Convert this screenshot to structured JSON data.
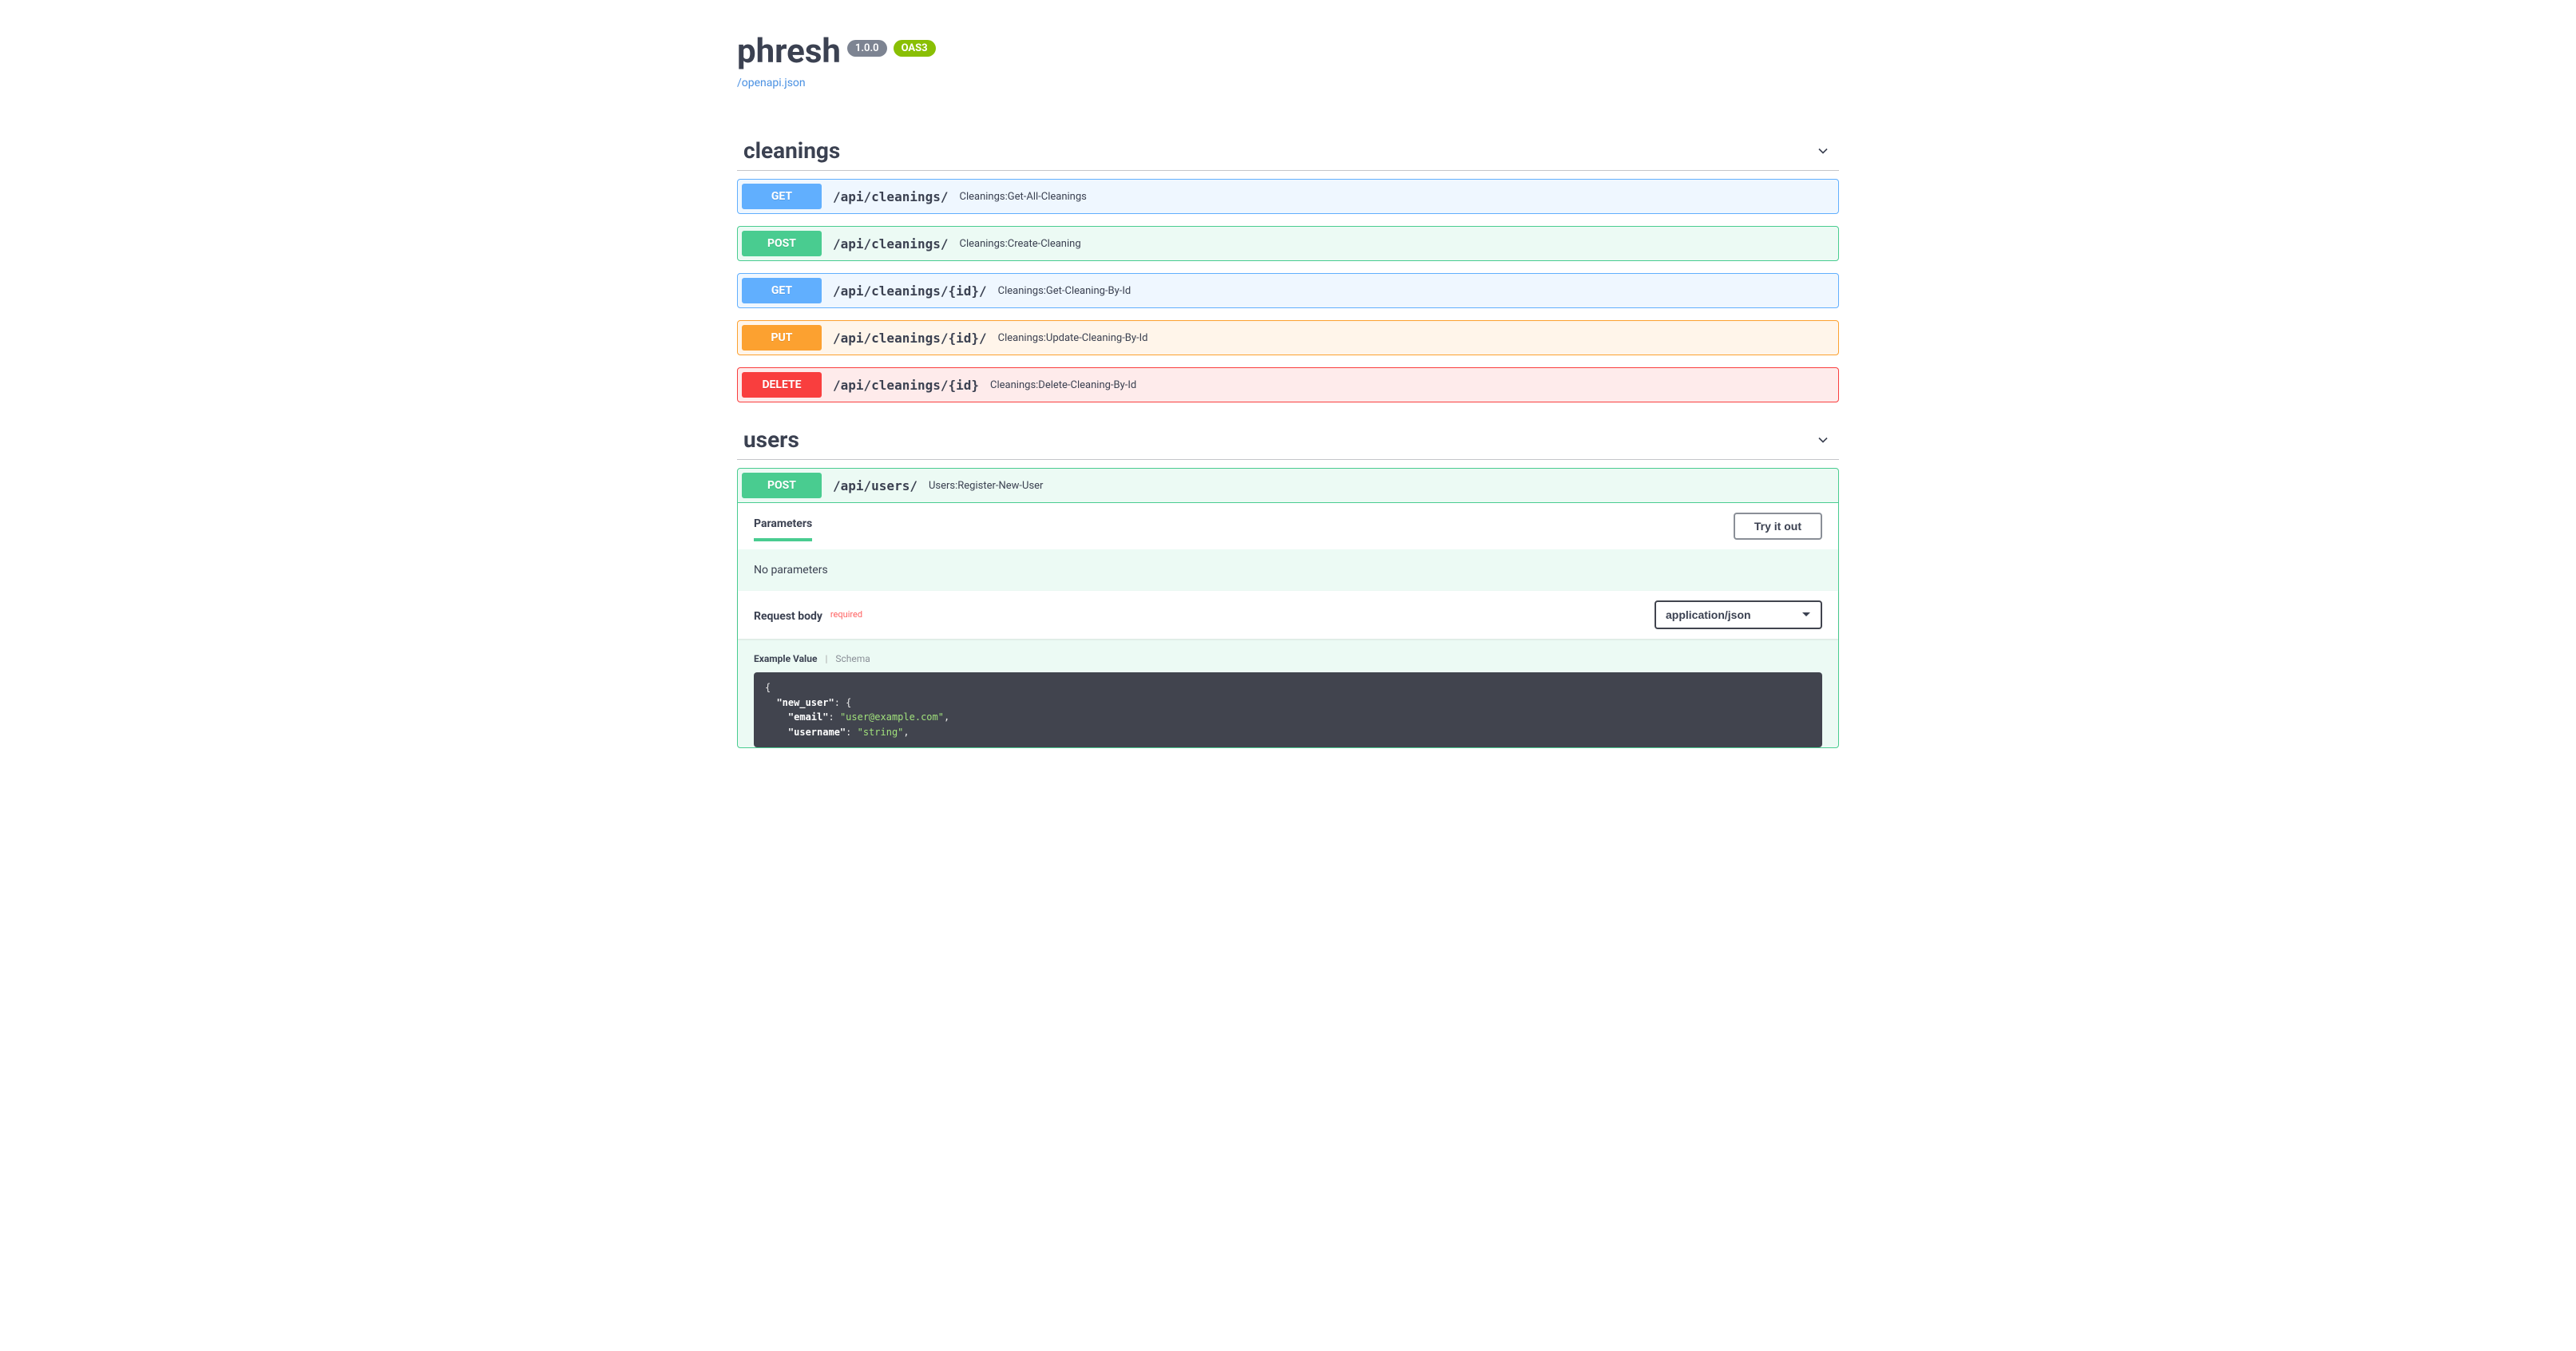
{
  "header": {
    "title": "phresh",
    "version": "1.0.0",
    "oas": "OAS3",
    "spec_link": "/openapi.json"
  },
  "tags": {
    "cleanings": {
      "name": "cleanings"
    },
    "users": {
      "name": "users"
    }
  },
  "ops": {
    "cleanings": [
      {
        "method": "GET",
        "path": "/api/cleanings/",
        "summary": "Cleanings:Get-All-Cleanings"
      },
      {
        "method": "POST",
        "path": "/api/cleanings/",
        "summary": "Cleanings:Create-Cleaning"
      },
      {
        "method": "GET",
        "path": "/api/cleanings/{id}/",
        "summary": "Cleanings:Get-Cleaning-By-Id"
      },
      {
        "method": "PUT",
        "path": "/api/cleanings/{id}/",
        "summary": "Cleanings:Update-Cleaning-By-Id"
      },
      {
        "method": "DELETE",
        "path": "/api/cleanings/{id}",
        "summary": "Cleanings:Delete-Cleaning-By-Id"
      }
    ],
    "users": [
      {
        "method": "POST",
        "path": "/api/users/",
        "summary": "Users:Register-New-User"
      }
    ]
  },
  "expanded": {
    "params_label": "Parameters",
    "try_label": "Try it out",
    "no_params": "No parameters",
    "reqbody_label": "Request body",
    "required_label": "required",
    "content_type": "application/json",
    "example_tab": "Example Value",
    "schema_tab": "Schema",
    "example_json": "{\n  \"new_user\": {\n    \"email\": \"user@example.com\",\n    \"username\": \"string\","
  }
}
